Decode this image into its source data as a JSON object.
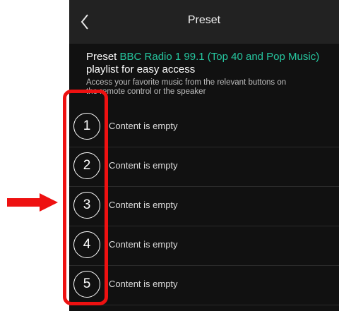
{
  "header": {
    "title": "Preset",
    "back_icon": "chevron-left-icon"
  },
  "intro": {
    "prefix": "Preset ",
    "station": "BBC Radio 1 99.1 (Top 40 and Pop Music)",
    "line2": "playlist for easy access",
    "sub1": "Access your favorite music from the relevant buttons on",
    "sub2": "the remote control or the speaker"
  },
  "presets": [
    {
      "number": "1",
      "label": "Content is empty"
    },
    {
      "number": "2",
      "label": "Content is empty"
    },
    {
      "number": "3",
      "label": "Content is empty"
    },
    {
      "number": "4",
      "label": "Content is empty"
    },
    {
      "number": "5",
      "label": "Content is empty"
    }
  ],
  "annotation": {
    "arrow_icon": "right-arrow-icon",
    "highlight_color": "#ee1111"
  },
  "colors": {
    "accent": "#26c7a0",
    "background": "#111111",
    "header": "#222222"
  }
}
